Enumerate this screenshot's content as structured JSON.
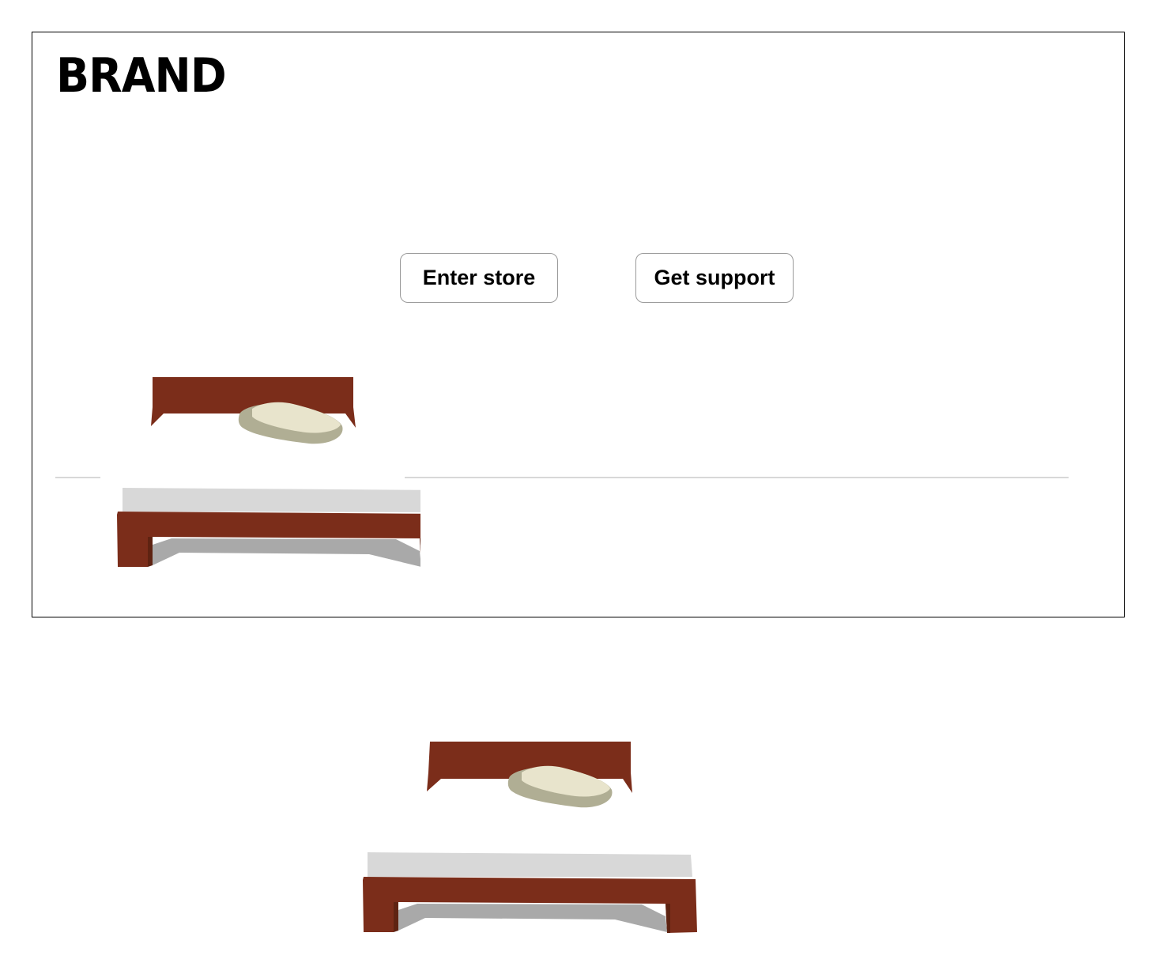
{
  "brand": {
    "logo_text": "BRAND"
  },
  "actions": {
    "enter_store_label": "Enter store",
    "get_support_label": "Get support"
  },
  "illustration": {
    "subject": "bed-illustration",
    "colors": {
      "frame": "#7b2d1a",
      "frame_dark": "#5e2312",
      "mattress": "#d8d8d8",
      "shadow": "#a9a9a9",
      "pillow_light": "#e8e4cc",
      "pillow_dark": "#b0ae94"
    }
  },
  "theme": {
    "border": "#000000",
    "button_border": "#9a9a9a",
    "divider": "#d8d8d8",
    "background": "#ffffff"
  }
}
